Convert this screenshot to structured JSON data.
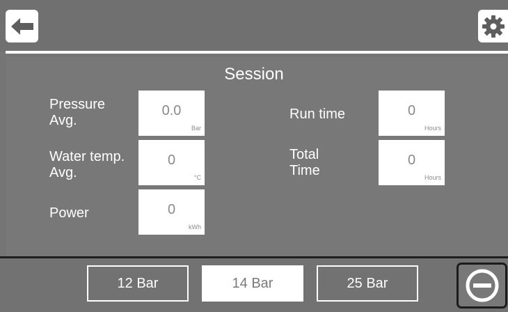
{
  "header": {
    "back_icon": "arrow-left-icon",
    "settings_icon": "gear-icon"
  },
  "session": {
    "title": "Session",
    "pressure": {
      "label_line1": "Pressure",
      "label_line2": "Avg.",
      "value": "0.0",
      "unit": "Bar"
    },
    "water_temp": {
      "label_line1": "Water temp.",
      "label_line2": "Avg.",
      "value": "0",
      "unit": "°C"
    },
    "power": {
      "label": "Power",
      "value": "0",
      "unit": "kWh"
    },
    "run_time": {
      "label": "Run time",
      "value": "0",
      "unit": "Hours"
    },
    "total_time": {
      "label_line1": "Total",
      "label_line2": "Time",
      "value": "0",
      "unit": "Hours"
    }
  },
  "footer": {
    "pressure_options": [
      "12 Bar",
      "14 Bar",
      "25 Bar"
    ],
    "selected_option": "14 Bar",
    "stop_icon": "minus-circle-icon"
  },
  "colors": {
    "background": "#757575",
    "accent": "#ffffff",
    "value_text": "#8a8a8a"
  }
}
